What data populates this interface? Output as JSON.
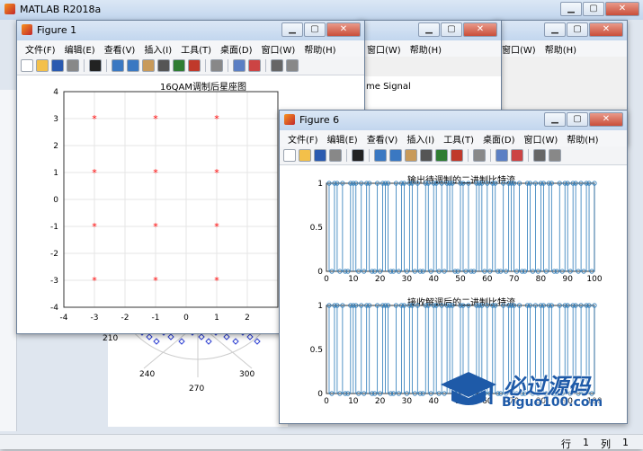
{
  "main_window": {
    "title": "MATLAB R2018a"
  },
  "statusbar": {
    "row_label": "行",
    "row_value": "1",
    "col_label": "列",
    "col_value": "1"
  },
  "background_polar": {
    "tick_labels": [
      "210",
      "240",
      "270",
      "300"
    ]
  },
  "figure_back": {
    "partial_title": "me Signal",
    "menu_partial": [
      "窗口(W)",
      "帮助(H)"
    ]
  },
  "figure1": {
    "title": "Figure 1",
    "menu": [
      "文件(F)",
      "编辑(E)",
      "查看(V)",
      "插入(I)",
      "工具(T)",
      "桌面(D)",
      "窗口(W)",
      "帮助(H)"
    ],
    "axes_title": "16QAM调制后星座图",
    "x_ticks": [
      "-4",
      "-3",
      "-2",
      "-1",
      "0",
      "1",
      "2"
    ],
    "y_ticks": [
      "4",
      "3",
      "2",
      "1",
      "0",
      "-1",
      "-2",
      "-3",
      "-4"
    ]
  },
  "figure6": {
    "title": "Figure 6",
    "menu": [
      "文件(F)",
      "编辑(E)",
      "查看(V)",
      "插入(I)",
      "工具(T)",
      "桌面(D)",
      "窗口(W)",
      "帮助(H)"
    ],
    "top_title": "输出待调制的二进制比特流",
    "bottom_title": "接收解调后的二进制比特流",
    "x_ticks": [
      "0",
      "10",
      "20",
      "30",
      "40",
      "50",
      "60",
      "70",
      "80",
      "90",
      "100"
    ],
    "y_ticks": [
      "1",
      "0.5",
      "0"
    ]
  },
  "watermark": {
    "title": "必过源码",
    "url": "Biguo100.com"
  },
  "chart_data": [
    {
      "type": "scatter",
      "title": "16QAM调制后星座图",
      "xlim": [
        -4,
        3
      ],
      "ylim": [
        -4,
        4
      ],
      "grid": true,
      "marker": "*",
      "color": "#ff0000",
      "points": [
        [
          -3,
          3
        ],
        [
          -1,
          3
        ],
        [
          1,
          3
        ],
        [
          -3,
          1
        ],
        [
          -1,
          1
        ],
        [
          1,
          1
        ],
        [
          -3,
          -1
        ],
        [
          -1,
          -1
        ],
        [
          1,
          -1
        ],
        [
          -3,
          -3
        ],
        [
          -1,
          -3
        ],
        [
          1,
          -3
        ]
      ]
    },
    {
      "type": "line",
      "title": "输出待调制的二进制比特流",
      "xlim": [
        0,
        100
      ],
      "ylim": [
        0,
        1
      ],
      "color": "#2a7ab9",
      "values": [
        1,
        0,
        1,
        1,
        0,
        1,
        0,
        0,
        1,
        1,
        1,
        0,
        1,
        0,
        1,
        1,
        0,
        0,
        1,
        0,
        1,
        1,
        1,
        0,
        0,
        1,
        0,
        1,
        1,
        0,
        1,
        1,
        0,
        1,
        0,
        0,
        1,
        1,
        0,
        1,
        1,
        0,
        1,
        0,
        1,
        1,
        1,
        0,
        0,
        1,
        1,
        0,
        1,
        0,
        0,
        1,
        1,
        1,
        0,
        1,
        0,
        1,
        1,
        0,
        0,
        1,
        0,
        1,
        1,
        1,
        0,
        1,
        0,
        0,
        1,
        1,
        0,
        1,
        0,
        1,
        1,
        0,
        1,
        1,
        0,
        0,
        1,
        0,
        1,
        1,
        0,
        1,
        1,
        0,
        1,
        0,
        1,
        1,
        0,
        1
      ]
    },
    {
      "type": "line",
      "title": "接收解调后的二进制比特流",
      "xlim": [
        0,
        100
      ],
      "ylim": [
        0,
        1
      ],
      "color": "#2a7ab9",
      "values": [
        1,
        0,
        1,
        1,
        0,
        1,
        0,
        0,
        1,
        1,
        1,
        0,
        1,
        0,
        1,
        1,
        0,
        0,
        1,
        0,
        1,
        1,
        1,
        0,
        0,
        1,
        0,
        1,
        1,
        0,
        1,
        1,
        0,
        1,
        0,
        0,
        1,
        1,
        0,
        1,
        1,
        0,
        1,
        0,
        1,
        1,
        1,
        0,
        0,
        1,
        1,
        0,
        1,
        0,
        0,
        1,
        1,
        1,
        0,
        1,
        0,
        1,
        1,
        0,
        0,
        1,
        0,
        1,
        1,
        1,
        0,
        1,
        0,
        0,
        1,
        1,
        0,
        1,
        0,
        1,
        1,
        0,
        1,
        1,
        0,
        0,
        1,
        0,
        1,
        1,
        0,
        1,
        1,
        0,
        1,
        0,
        1,
        1,
        0,
        1
      ]
    }
  ]
}
